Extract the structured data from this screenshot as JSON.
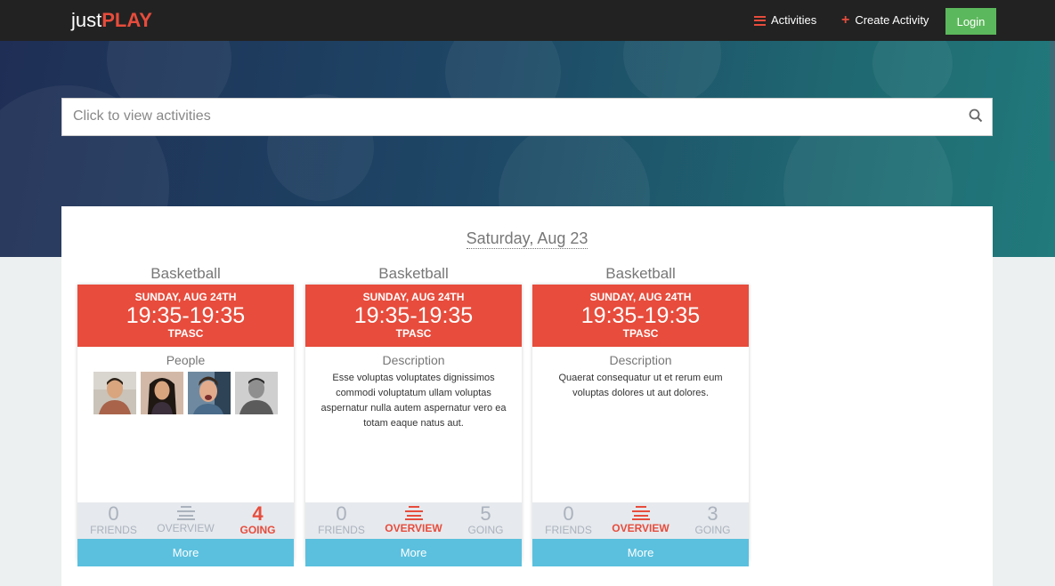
{
  "brand": {
    "part1": "just",
    "part2": "PLAY"
  },
  "nav": {
    "activities": "Activities",
    "create": "Create Activity",
    "login": "Login"
  },
  "search": {
    "placeholder": "Click to view activities"
  },
  "date_heading": "Saturday, Aug 23",
  "cards": [
    {
      "sport": "Basketball",
      "date": "SUNDAY, AUG 24TH",
      "time": "19:35-19:35",
      "venue": "TPASC",
      "section_title": "People",
      "description": "",
      "stats": {
        "friends_num": "0",
        "friends_label": "FRIENDS",
        "overview_label": "OVERVIEW",
        "going_num": "4",
        "going_label": "GOING"
      },
      "active": "going",
      "more": "More"
    },
    {
      "sport": "Basketball",
      "date": "SUNDAY, AUG 24TH",
      "time": "19:35-19:35",
      "venue": "TPASC",
      "section_title": "Description",
      "description": "Esse voluptas voluptates dignissimos commodi voluptatum ullam voluptas aspernatur nulla autem aspernatur vero ea totam eaque natus aut.",
      "stats": {
        "friends_num": "0",
        "friends_label": "FRIENDS",
        "overview_label": "OVERVIEW",
        "going_num": "5",
        "going_label": "GOING"
      },
      "active": "overview",
      "more": "More"
    },
    {
      "sport": "Basketball",
      "date": "SUNDAY, AUG 24TH",
      "time": "19:35-19:35",
      "venue": "TPASC",
      "section_title": "Description",
      "description": "Quaerat consequatur ut et rerum eum voluptas dolores ut aut dolores.",
      "stats": {
        "friends_num": "0",
        "friends_label": "FRIENDS",
        "overview_label": "OVERVIEW",
        "going_num": "3",
        "going_label": "GOING"
      },
      "active": "overview",
      "more": "More"
    }
  ],
  "colors": {
    "accent": "#e74c3c",
    "login": "#5cb85c",
    "more": "#5bc0de",
    "navbar": "#222222"
  }
}
